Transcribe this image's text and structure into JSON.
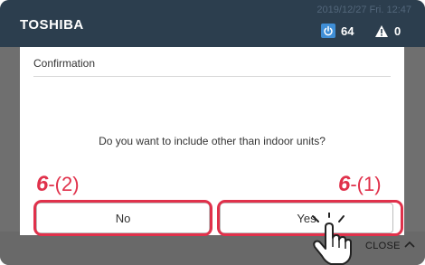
{
  "header": {
    "brand": "TOSHIBA",
    "datetime": "2019/12/27 Fri. 12:47",
    "power_count": "64",
    "alert_count": "0"
  },
  "dialog": {
    "title": "Confirmation",
    "message": "Do you want to include other than indoor units?",
    "no_label": "No",
    "yes_label": "Yes"
  },
  "annotations": {
    "no_step_num": "6",
    "no_step_sub": "-(2)",
    "yes_step_num": "6",
    "yes_step_sub": "-(1)"
  },
  "footer": {
    "close_label": "CLOSE"
  },
  "colors": {
    "header_bg": "#2c3e4e",
    "accent_blue": "#3f8ed6",
    "highlight_red": "#e0314b"
  },
  "icons": [
    "power-icon",
    "alert-icon",
    "chevron-up-icon",
    "hand-pointer-icon"
  ]
}
